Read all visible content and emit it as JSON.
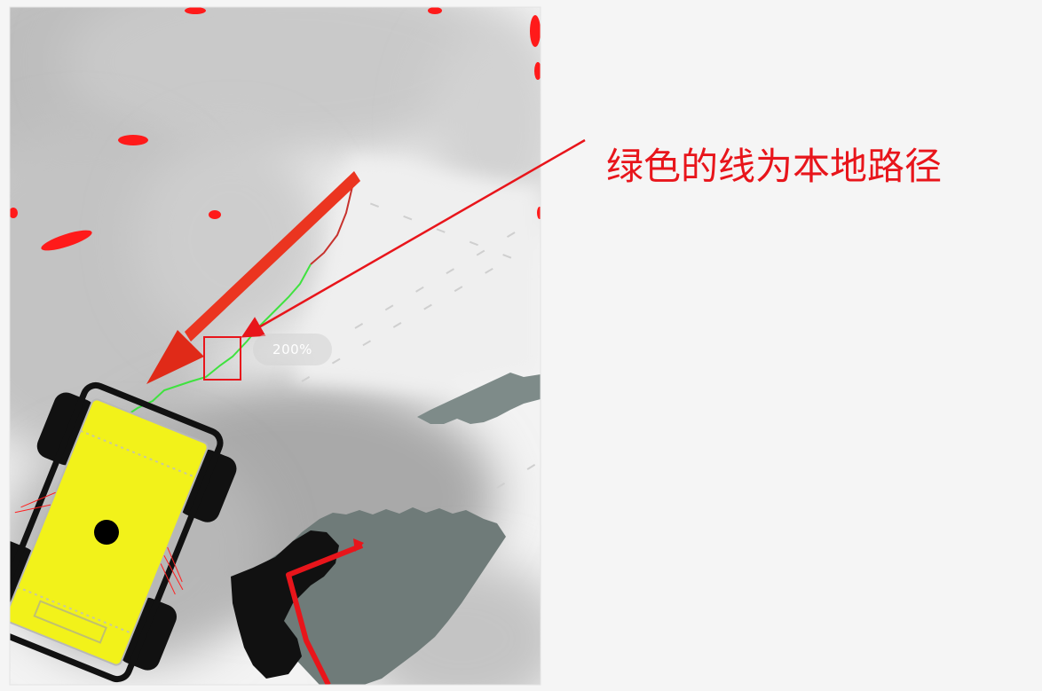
{
  "annotation": {
    "caption": "绿色的线为本地路径",
    "color": "#e8151b"
  },
  "viewer": {
    "zoom_label": "200%"
  },
  "colors": {
    "page_bg": "#f5f5f5",
    "robot_body": "#f2f21a",
    "local_path": "#3fe23f",
    "goal_arrow": "#e02a18",
    "obstacle_points": "#ff1a1a"
  },
  "icons": {
    "robot": "yellow-four-wheel-robot-icon",
    "goal": "red-goal-arrow-icon"
  }
}
